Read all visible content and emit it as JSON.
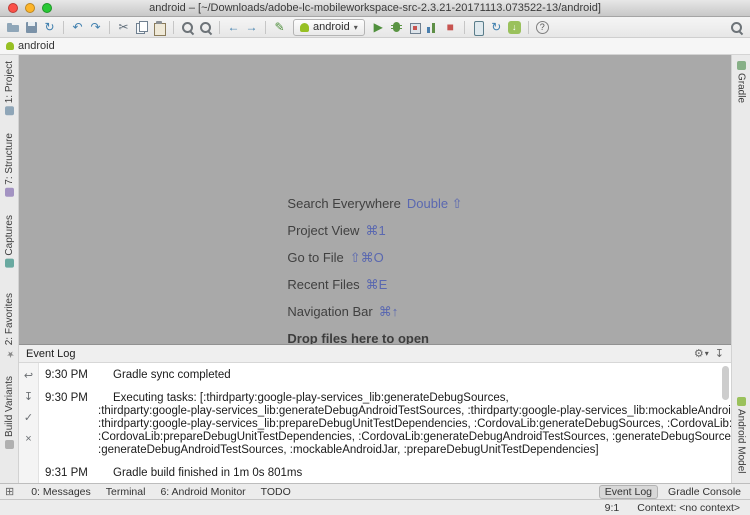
{
  "titlebar": {
    "title": "android – [~/Downloads/adobe-lc-mobileworkspace-src-2.3.21-20171113.073522-13/android]"
  },
  "navbar": {
    "module": "android"
  },
  "toolbar": {
    "run_config": "android"
  },
  "glyphs": {
    "sync": "↻",
    "undo": "↶",
    "redo": "↷",
    "cut": "✂",
    "back": "←",
    "forward": "→",
    "edit": "✎",
    "run": "▶",
    "stop": "■",
    "gradle_sync": "↻",
    "gear": "⚙",
    "caret_down": "▾",
    "hide": "↧",
    "soft_wrap": "↩",
    "scroll_end": "↧",
    "mark_read": "✓",
    "clear": "×",
    "switcher": "⊞",
    "star": "★"
  },
  "editor": {
    "shortcuts": [
      {
        "label": "Search Everywhere",
        "keys": "Double ⇧"
      },
      {
        "label": "Project View",
        "keys": "⌘1"
      },
      {
        "label": "Go to File",
        "keys": "⇧⌘O"
      },
      {
        "label": "Recent Files",
        "keys": "⌘E"
      },
      {
        "label": "Navigation Bar",
        "keys": "⌘↑"
      }
    ],
    "drop_hint": "Drop files here to open"
  },
  "left_stripe": {
    "top": [
      {
        "label": "1: Project"
      },
      {
        "label": "7: Structure"
      },
      {
        "label": "Captures"
      }
    ],
    "bottom": [
      {
        "label": "2: Favorites"
      },
      {
        "label": "Build Variants"
      }
    ]
  },
  "right_stripe": {
    "top": [
      {
        "label": "Gradle"
      }
    ],
    "bottom": [
      {
        "label": "Android Model"
      }
    ]
  },
  "event_log": {
    "title": "Event Log",
    "messages": [
      {
        "time": "9:30 PM",
        "text": "Gradle sync completed",
        "cont": []
      },
      {
        "time": "9:30 PM",
        "text": "Executing tasks: [:thirdparty:google-play-services_lib:generateDebugSources,",
        "cont": [
          ":thirdparty:google-play-services_lib:generateDebugAndroidTestSources, :thirdparty:google-play-services_lib:mockableAndroidJar,",
          ":thirdparty:google-play-services_lib:prepareDebugUnitTestDependencies, :CordovaLib:generateDebugSources, :CordovaLib:mockableAndroidJa",
          ":CordovaLib:prepareDebugUnitTestDependencies, :CordovaLib:generateDebugAndroidTestSources, :generateDebugSources,",
          ":generateDebugAndroidTestSources, :mockableAndroidJar, :prepareDebugUnitTestDependencies]"
        ]
      },
      {
        "time": "9:31 PM",
        "text": "Gradle build finished in 1m 0s 801ms",
        "cont": []
      }
    ]
  },
  "bottom_bar": {
    "left": [
      {
        "label": "0: Messages"
      },
      {
        "label": "Terminal"
      },
      {
        "label": "6: Android Monitor"
      },
      {
        "label": "TODO"
      }
    ],
    "right": [
      {
        "label": "Event Log"
      },
      {
        "label": "Gradle Console"
      }
    ]
  },
  "status_bar": {
    "caret_position": "9:1",
    "context": "Context: <no context>"
  }
}
